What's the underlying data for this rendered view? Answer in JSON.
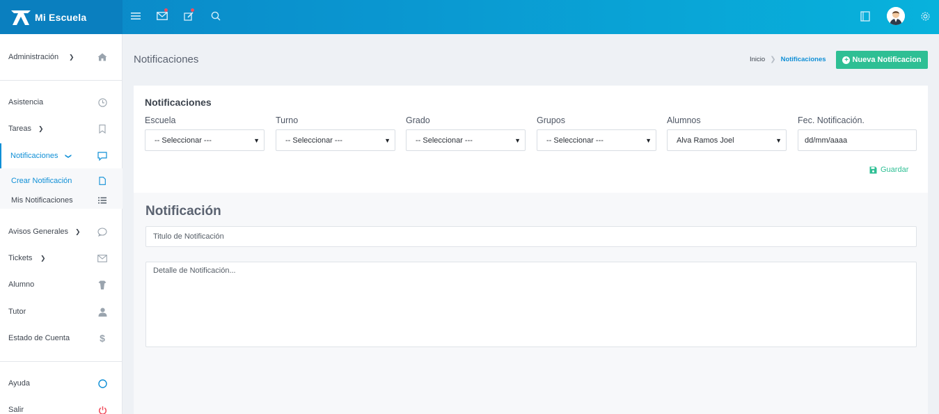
{
  "app": {
    "name": "Mi Escuela"
  },
  "sidebar": {
    "items": [
      {
        "label": "Administración",
        "icon": "home-icon"
      },
      {
        "label": "Asistencia",
        "icon": "clock-icon"
      },
      {
        "label": "Tareas",
        "icon": "bookmark-icon"
      },
      {
        "label": "Notificaciones",
        "icon": "comment-icon"
      },
      {
        "label": "Avisos Generales",
        "icon": "chat-bubble-icon"
      },
      {
        "label": "Tickets",
        "icon": "envelope-icon"
      },
      {
        "label": "Alumno",
        "icon": "student-icon"
      },
      {
        "label": "Tutor",
        "icon": "user-icon"
      },
      {
        "label": "Estado de Cuenta",
        "icon": "dollar-icon"
      },
      {
        "label": "Ayuda",
        "icon": "help-circle-icon"
      },
      {
        "label": "Salir",
        "icon": "power-icon"
      }
    ],
    "sub": [
      {
        "label": "Crear Notificación",
        "icon": "file-icon"
      },
      {
        "label": "Mis Notificaciones",
        "icon": "list-icon"
      }
    ]
  },
  "header": {
    "title": "Notificaciones",
    "breadcrumb": [
      "Inicio",
      "Notificaciones"
    ],
    "new_button": "Nueva Notificacion"
  },
  "filters": {
    "title": "Notificaciones",
    "fields": [
      {
        "label": "Escuela",
        "value": "-- Seleccionar ---"
      },
      {
        "label": "Turno",
        "value": "-- Seleccionar ---"
      },
      {
        "label": "Grado",
        "value": "-- Seleccionar ---"
      },
      {
        "label": "Grupos",
        "value": "-- Seleccionar ---"
      },
      {
        "label": "Alumnos",
        "value": "Alva Ramos Joel"
      }
    ],
    "date": {
      "label": "Fec. Notificación.",
      "placeholder": "dd/mm/aaaa"
    },
    "save_label": "Guardar"
  },
  "notification": {
    "title": "Notificación",
    "title_placeholder": "Titulo de Notificación",
    "detail_placeholder": "Detalle de Notificación..."
  },
  "colors": {
    "primary": "#0f8fd6",
    "accent": "#2ebf94",
    "danger": "#f04e5e"
  }
}
